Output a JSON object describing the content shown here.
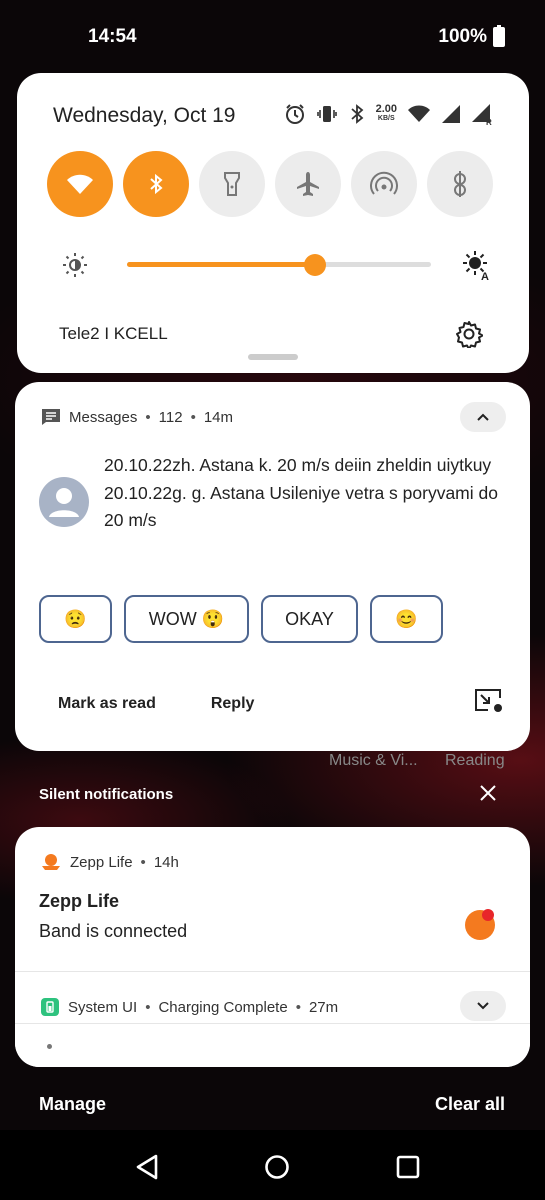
{
  "status_bar": {
    "time": "14:54",
    "battery": "100%"
  },
  "quick_settings": {
    "date": "Wednesday, Oct 19",
    "net_speed_value": "2.00",
    "net_speed_unit": "KB/S",
    "brightness_level": 0.62,
    "carrier": "Tele2 I KCELL",
    "tiles": [
      {
        "name": "wifi",
        "on": true
      },
      {
        "name": "bluetooth",
        "on": true
      },
      {
        "name": "flashlight",
        "on": false
      },
      {
        "name": "airplane-mode",
        "on": false
      },
      {
        "name": "hotspot",
        "on": false
      },
      {
        "name": "nfc",
        "on": false
      }
    ],
    "accent_color": "#f7931e"
  },
  "messages_notification": {
    "app": "Messages",
    "count": "112",
    "time": "14m",
    "lines": [
      "20.10.22zh. Astana k. 20 m/s deiin zheldin uiytkuy",
      "20.10.22g. g. Astana Usileniye vetra s poryvami do 20 m/s"
    ],
    "smart_replies": [
      "😟",
      "WOW 😲",
      "OKAY",
      "😊"
    ],
    "actions": {
      "mark_read": "Mark as read",
      "reply": "Reply"
    }
  },
  "background_labels": {
    "music": "Music & Vi...",
    "reading": "Reading"
  },
  "silent": {
    "label": "Silent notifications"
  },
  "zepp_notification": {
    "app": "Zepp Life",
    "time": "14h",
    "title": "Zepp Life",
    "body": "Band is connected"
  },
  "system_notification": {
    "app": "System UI",
    "title": "Charging Complete",
    "time": "27m"
  },
  "footer": {
    "manage": "Manage",
    "clear_all": "Clear all"
  },
  "separator": "•"
}
